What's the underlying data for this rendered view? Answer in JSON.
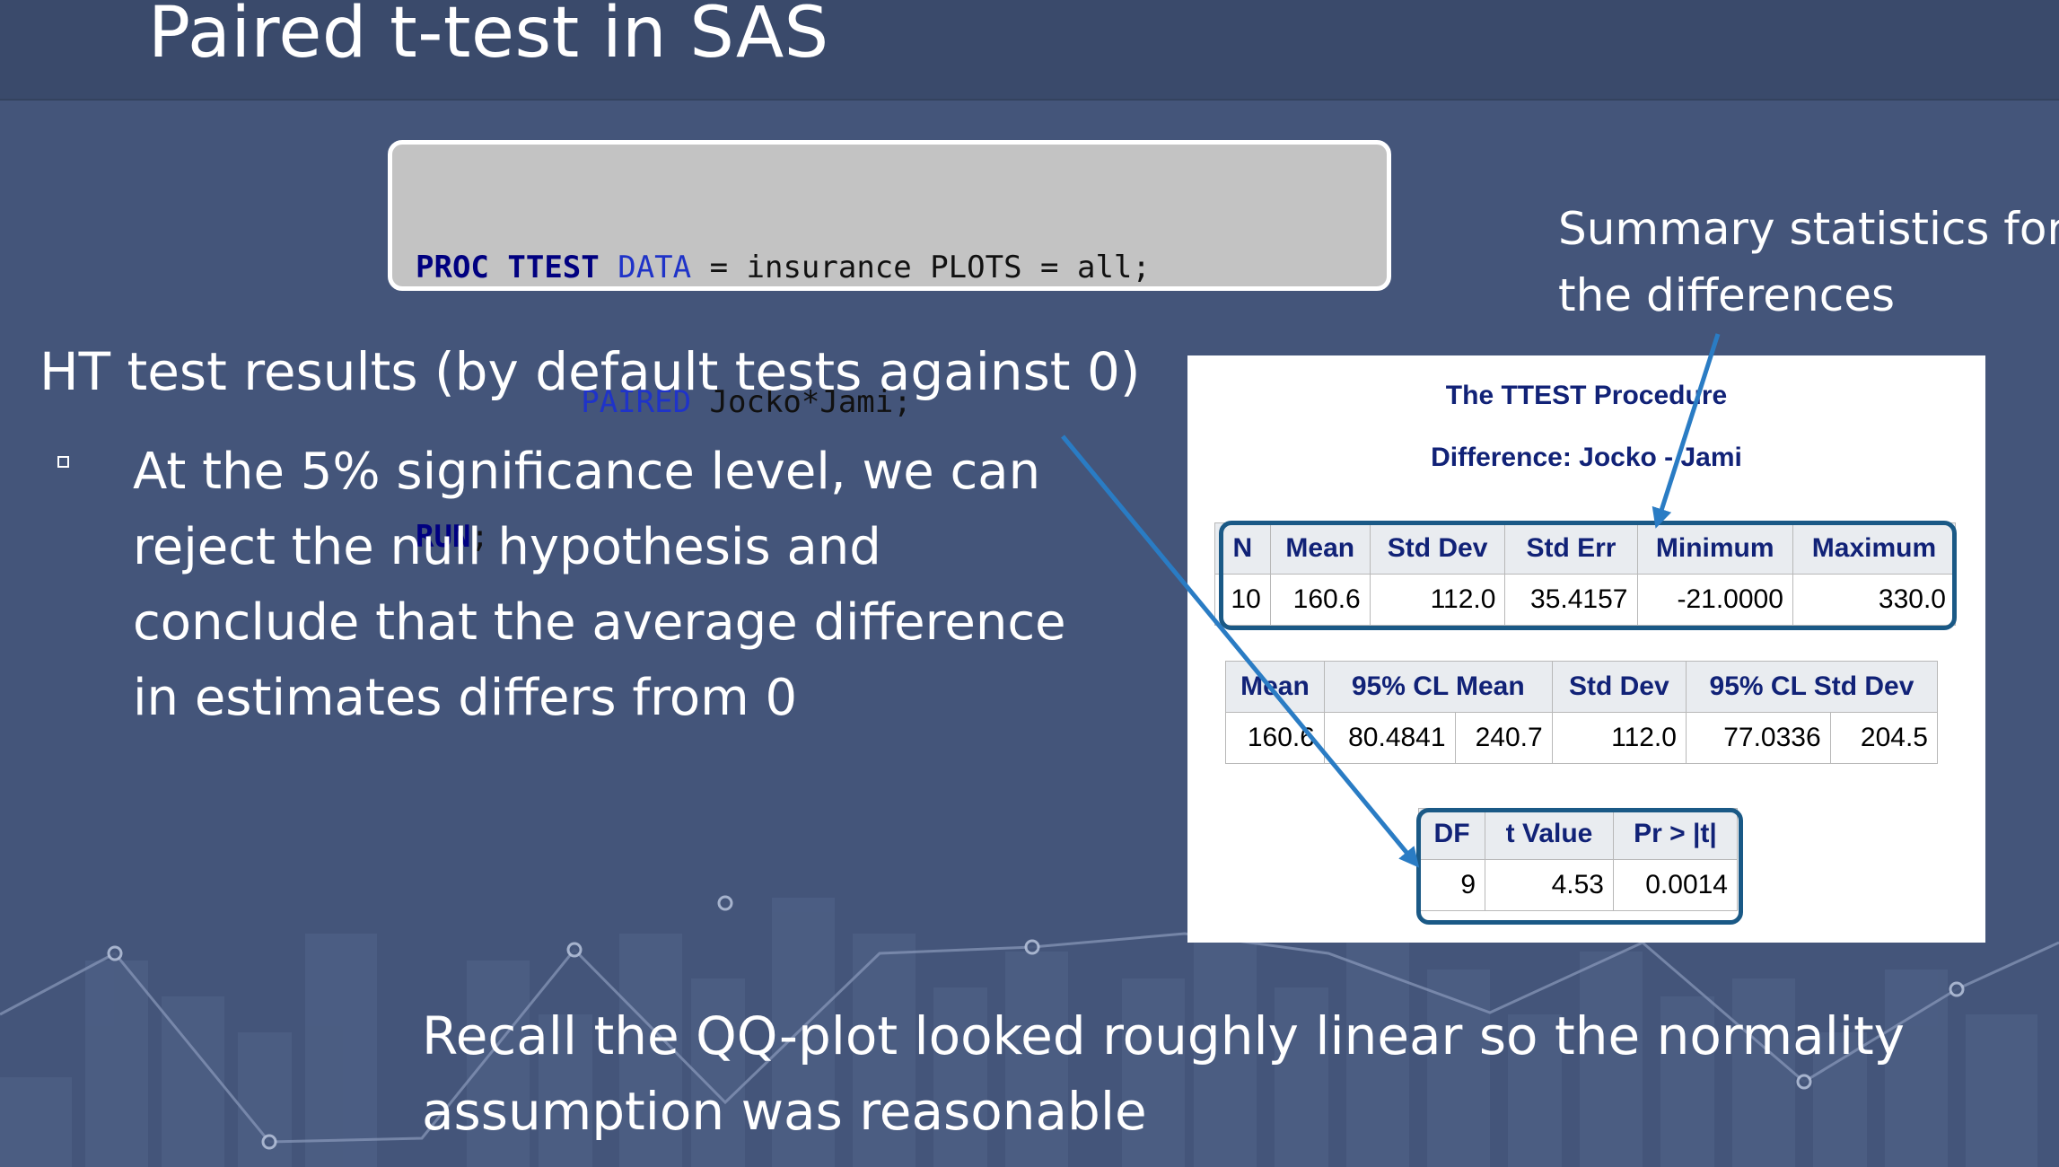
{
  "slide": {
    "title": "Paired t-test in SAS",
    "colors": {
      "background": "#44557a",
      "accent_arrow": "#2a7cc4",
      "highlight_border": "#1a5986",
      "sas_header_text": "#112277"
    }
  },
  "code": {
    "line1": {
      "kw_proc": "PROC",
      "kw_ttest": "TTEST",
      "kw_data": "DATA",
      "rest": " = insurance PLOTS = all;"
    },
    "line2": {
      "kw_paired": "PAIRED",
      "rest": " Jocko*Jami;"
    },
    "line3": {
      "kw_run": "RUN",
      "rest": ";"
    }
  },
  "annotation_summary": [
    "Summary statistics for",
    "the differences"
  ],
  "ht_heading": "HT test results (by default tests against 0)",
  "bullet": {
    "icon": "square-bullet-icon",
    "lines": [
      "At the 5% significance level, we can",
      "reject the null hypothesis and",
      "conclude that the average difference",
      "in estimates differs from 0"
    ]
  },
  "recall": [
    "Recall the QQ-plot looked roughly linear so the normality",
    "assumption was reasonable"
  ],
  "sas_output": {
    "procedure_title": "The TTEST Procedure",
    "difference_title": "Difference: Jocko - Jami",
    "summary_table": {
      "headers": [
        "N",
        "Mean",
        "Std Dev",
        "Std Err",
        "Minimum",
        "Maximum"
      ],
      "row": [
        "10",
        "160.6",
        "112.0",
        "35.4157",
        "-21.0000",
        "330.0"
      ]
    },
    "ci_table": {
      "headers": [
        "Mean",
        "95% CL Mean",
        "Std Dev",
        "95% CL Std Dev"
      ],
      "row": [
        "160.6",
        "80.4841",
        "240.7",
        "112.0",
        "77.0336",
        "204.5"
      ]
    },
    "test_table": {
      "headers": [
        "DF",
        "t Value",
        "Pr > |t|"
      ],
      "row": [
        "9",
        "4.53",
        "0.0014"
      ]
    }
  }
}
